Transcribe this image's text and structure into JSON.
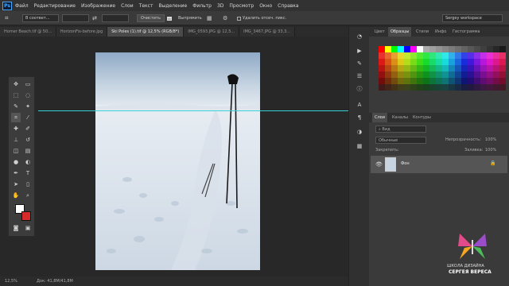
{
  "app": {
    "logo": "Ps"
  },
  "menu": [
    "Файл",
    "Редактирование",
    "Изображение",
    "Слои",
    "Текст",
    "Выделение",
    "Фильтр",
    "3D",
    "Просмотр",
    "Окно",
    "Справка"
  ],
  "options": {
    "mode": "В соответ...",
    "clear_btn": "Очистить",
    "straighten": "Выпрямить",
    "delete_cropped": "Удалить отсеч. пикс.",
    "workspace": "Sergey workspace"
  },
  "tabs": [
    {
      "label": "Homer Beach.tif @ 50...",
      "active": false
    },
    {
      "label": "HorizonFix-before.jpg",
      "active": false
    },
    {
      "label": "Ski Poles (1).tif @ 12,5% (RGB/8*)",
      "active": true
    },
    {
      "label": "IMG_0593.JPG @ 12,5...",
      "active": false
    },
    {
      "label": "IMG_3467.JPG @ 33,3...",
      "active": false
    }
  ],
  "status": {
    "zoom": "12,5%",
    "doc": "Док: 41,8M/41,8M"
  },
  "swatch_panel": {
    "tabs": [
      "Цвет",
      "Образцы",
      "Стили",
      "Инфо",
      "Гистограмма"
    ],
    "active": "Образцы"
  },
  "layers_panel": {
    "tabs": [
      "Слои",
      "Каналы",
      "Контуры"
    ],
    "active": "Слои",
    "filter": "Вид",
    "blend": "Обычные",
    "opacity_label": "Непрозрачность:",
    "opacity": "100%",
    "lock_label": "Закрепить:",
    "fill_label": "Заливка:",
    "fill": "100%",
    "layers": [
      {
        "name": "Фон"
      }
    ]
  },
  "watermark": {
    "line1": "ШКОЛА ДИЗАЙНА",
    "line2": "СЕРГЕЯ ВЕРЕСА"
  },
  "colors": {
    "fg": "#ffffff",
    "bg": "#d42a2a",
    "guide": "#34d2d8"
  }
}
